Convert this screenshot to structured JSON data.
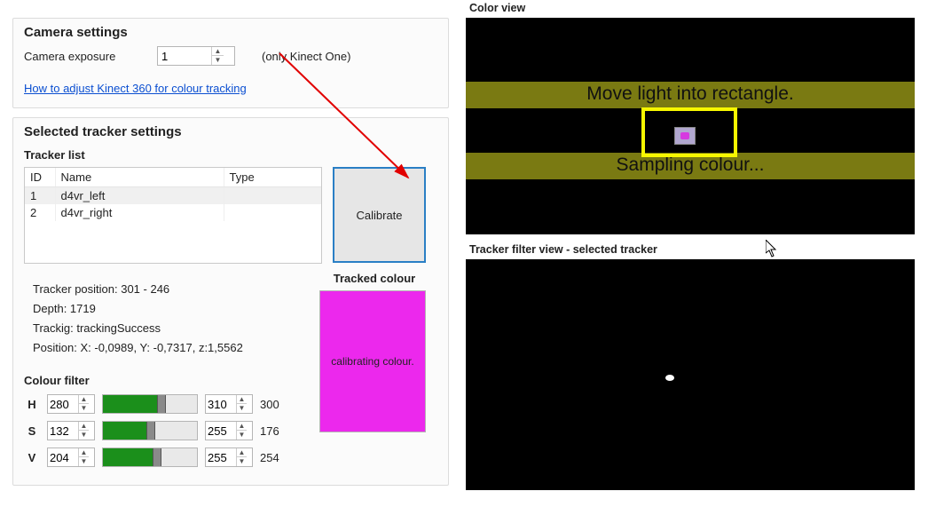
{
  "camera": {
    "title": "Camera settings",
    "exposure_label": "Camera exposure",
    "exposure_value": "1",
    "only_kinect": "(only Kinect One)",
    "link_text": "How to adjust Kinect 360 for colour tracking"
  },
  "tracker": {
    "title": "Selected tracker settings",
    "list_title": "Tracker list",
    "columns": {
      "id": "ID",
      "name": "Name",
      "type": "Type"
    },
    "rows": [
      {
        "id": "1",
        "name": "d4vr_left",
        "type": ""
      },
      {
        "id": "2",
        "name": "d4vr_right",
        "type": ""
      }
    ],
    "calibrate_label": "Calibrate",
    "info": {
      "pos": "Tracker position: 301 - 246",
      "depth": "Depth: 1719",
      "status": "Trackig: trackingSuccess",
      "xyz": "Position: X: -0,0989, Y: -0,7317, z:1,5562"
    },
    "tracked_colour_title": "Tracked colour",
    "tracked_colour_text": "calibrating colour.",
    "tracked_colour_hex": "#ec28ed"
  },
  "filter": {
    "title": "Colour filter",
    "h": {
      "label": "H",
      "lo": "280",
      "hi": "310",
      "readout": "300"
    },
    "s": {
      "label": "S",
      "lo": "132",
      "hi": "255",
      "readout": "176"
    },
    "v": {
      "label": "V",
      "lo": "204",
      "hi": "255",
      "readout": "254"
    }
  },
  "views": {
    "color_title": "Color view",
    "filter_title": "Tracker filter view - selected tracker",
    "msg_top": "Move light into rectangle.",
    "msg_bottom": "Sampling colour..."
  }
}
